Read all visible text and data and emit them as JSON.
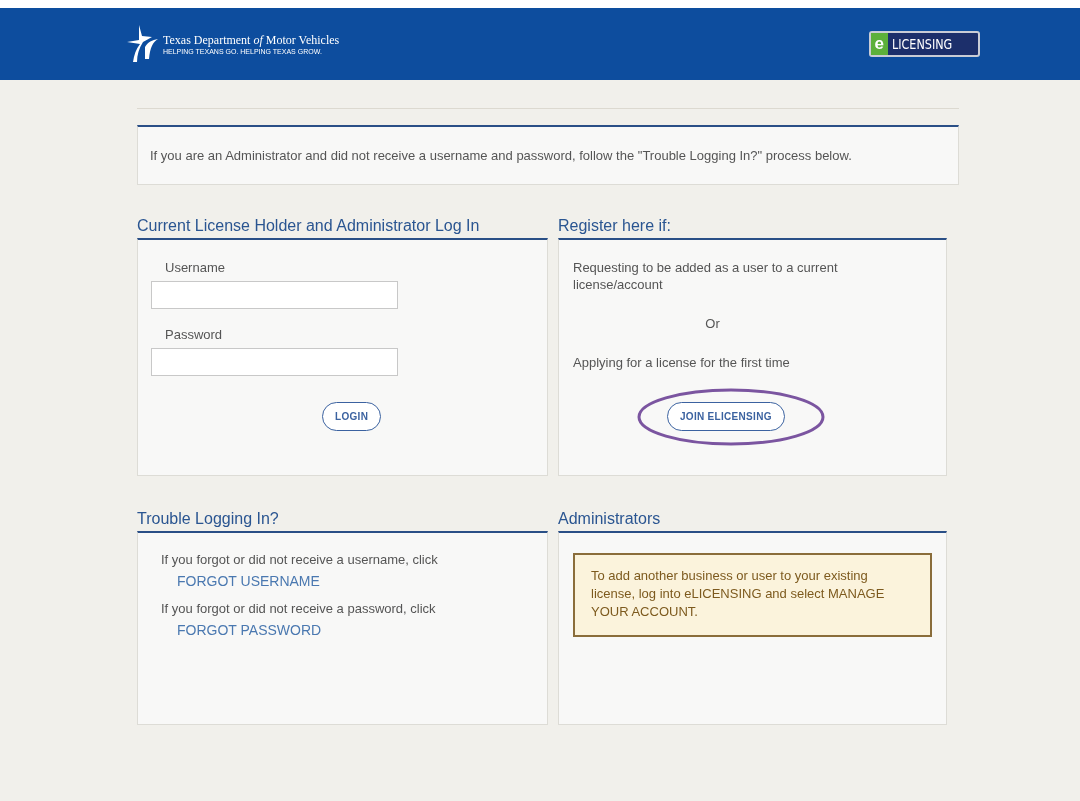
{
  "header": {
    "agency_name": "Texas Department *of* Motor Vehicles",
    "tagline": "HELPING TEXANS GO. HELPING TEXAS GROW.",
    "badge_letter": "e",
    "badge_text": "LICENSING"
  },
  "notice": "If you are an Administrator and did not receive a username and password, follow the \"Trouble Logging In?\" process below.",
  "login": {
    "heading": "Current License Holder and Administrator Log In",
    "fields": [
      {
        "label": "Username"
      },
      {
        "label": "Password"
      }
    ],
    "button": "LOGIN"
  },
  "register": {
    "heading": "Register here if:",
    "option_1": "Requesting to be added as a user to a current license/account",
    "separator": "Or",
    "option_2": "Applying for a license for the first time",
    "button": {
      "label": "JOIN ELICENSING",
      "highlighted": true
    }
  },
  "trouble": {
    "heading": "Trouble Logging In?",
    "items": [
      {
        "text": "If you forgot or did not receive a username, click",
        "link": "FORGOT USERNAME"
      },
      {
        "text": "If you forgot or did not receive a password, click",
        "link": "FORGOT PASSWORD"
      }
    ]
  },
  "administrators": {
    "heading": "Administrators",
    "message": "To add another business or user to your existing license, log into eLICENSING and select MANAGE YOUR ACCOUNT."
  }
}
